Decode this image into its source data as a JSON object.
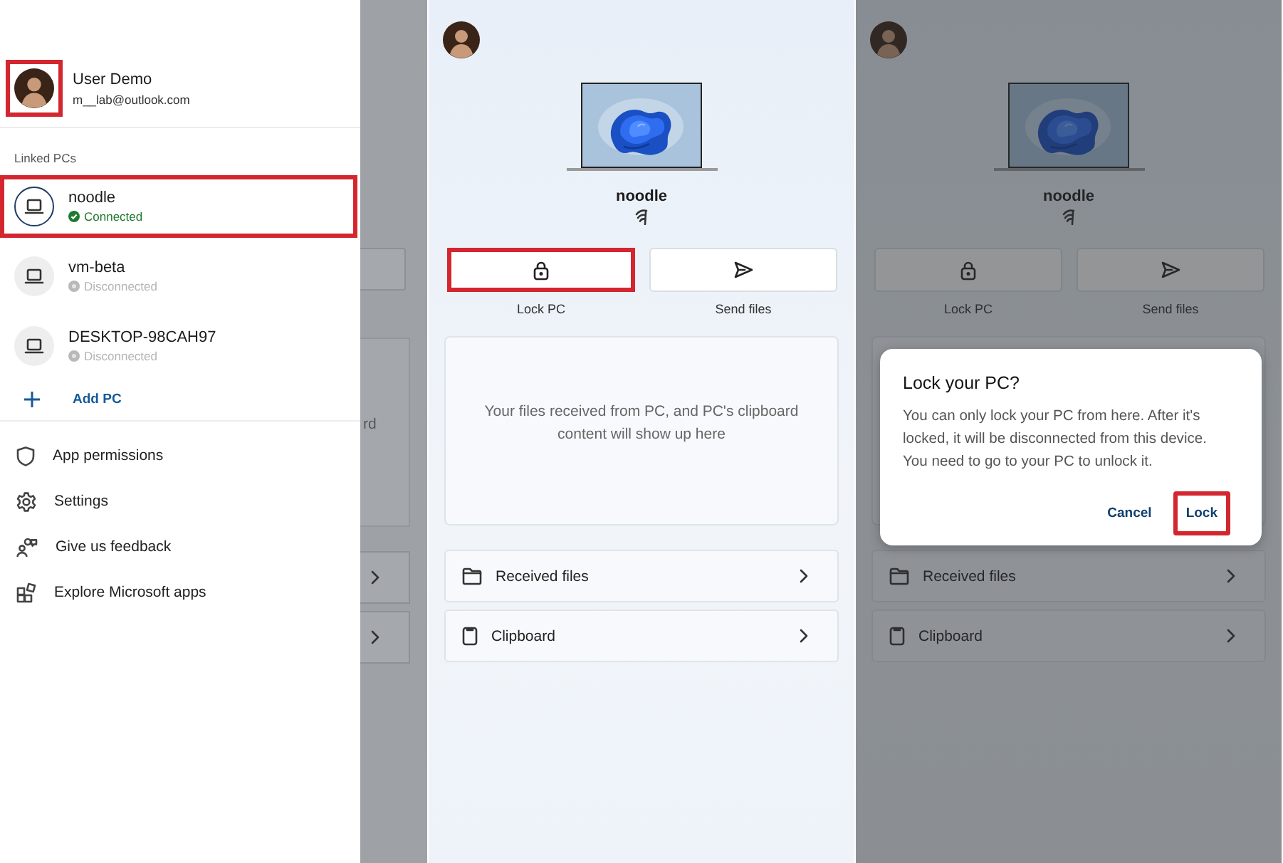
{
  "panels": [
    {
      "kind": "drawer",
      "account": {
        "name": "User Demo",
        "email": "m__lab@outlook.com",
        "highlighted": true
      },
      "section_label": "Linked PCs",
      "pcs": [
        {
          "name": "noodle",
          "status": "Connected",
          "connected": true,
          "selected": true,
          "highlighted": true
        },
        {
          "name": "vm-beta",
          "status": "Disconnected",
          "connected": false,
          "selected": false,
          "highlighted": false
        },
        {
          "name": "DESKTOP-98CAH97",
          "status": "Disconnected",
          "connected": false,
          "selected": false,
          "highlighted": false
        }
      ],
      "add_pc": "Add PC",
      "menu": [
        {
          "label": "App permissions",
          "kind": "permissions"
        },
        {
          "label": "Settings",
          "kind": "settings"
        },
        {
          "label": "Give us feedback",
          "kind": "feedback"
        },
        {
          "label": "Explore Microsoft apps",
          "kind": "apps"
        }
      ],
      "backdrop_text": "rd"
    },
    {
      "kind": "device",
      "dimmed": false,
      "device_name": "noodle",
      "actions": [
        {
          "label": "Lock PC",
          "kind": "lock",
          "highlighted": true
        },
        {
          "label": "Send files",
          "kind": "send",
          "highlighted": false
        }
      ],
      "empty_message": "Your files received from PC, and PC's clipboard content will show up here",
      "links": [
        {
          "label": "Received files",
          "kind": "folder"
        },
        {
          "label": "Clipboard",
          "kind": "clipboard"
        }
      ]
    },
    {
      "kind": "device",
      "dimmed": true,
      "device_name": "noodle",
      "actions": [
        {
          "label": "Lock PC",
          "kind": "lock",
          "highlighted": false
        },
        {
          "label": "Send files",
          "kind": "send",
          "highlighted": false
        }
      ],
      "links": [
        {
          "label": "Received files",
          "kind": "folder"
        },
        {
          "label": "Clipboard",
          "kind": "clipboard"
        }
      ],
      "dialog": {
        "title": "Lock your PC?",
        "body": "You can only lock your PC from here. After it's locked, it will be disconnected from this device. You need to go to your PC to unlock it.",
        "buttons": [
          {
            "label": "Cancel",
            "highlighted": false
          },
          {
            "label": "Lock",
            "highlighted": true
          }
        ]
      }
    }
  ]
}
